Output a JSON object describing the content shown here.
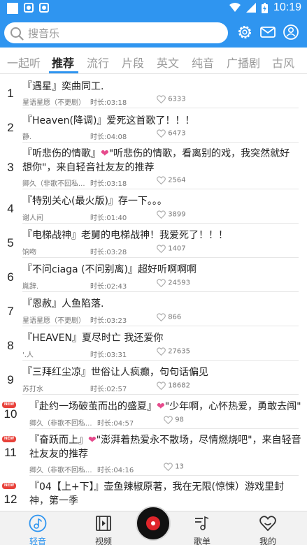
{
  "status": {
    "time": "10:19"
  },
  "search": {
    "placeholder": "搜音乐"
  },
  "tabs": [
    {
      "label": "一起听",
      "active": false
    },
    {
      "label": "推荐",
      "active": true
    },
    {
      "label": "流行",
      "active": false
    },
    {
      "label": "片段",
      "active": false
    },
    {
      "label": "英文",
      "active": false
    },
    {
      "label": "纯音",
      "active": false
    },
    {
      "label": "广播剧",
      "active": false
    },
    {
      "label": "古风",
      "active": false
    }
  ],
  "songs": [
    {
      "rank": "1",
      "title": "『遇星』奕曲同工.",
      "author": "星语星愿（不更剧）",
      "duration": "时长:03:18",
      "likes": "6333",
      "new": false
    },
    {
      "rank": "2",
      "title": "『Heaven(降调)』爱死这首歌了！！！",
      "author": "静.",
      "duration": "时长:04:08",
      "likes": "6473",
      "new": false
    },
    {
      "rank": "3",
      "title_pre": "『听悲伤的情歌』",
      "title_post": "\"听悲伤的情歌，看离别的戏，我突然就好想你\"，来自轻音社友友的推荐",
      "author": "卿久（非歌不回私...",
      "duration": "时长:03:18",
      "likes": "2564",
      "new": false
    },
    {
      "rank": "4",
      "title": "『特别关心(最火版)』存一下。。。",
      "author": "谢人间",
      "duration": "时长:01:40",
      "likes": "3899",
      "new": false
    },
    {
      "rank": "5",
      "title": "『电梯战神』老舅的电梯战神！我爱死了！！！",
      "author": "饷吻",
      "duration": "时长:03:28",
      "likes": "1407",
      "new": false
    },
    {
      "rank": "6",
      "title": "『不问ciaga (不问别离)』超好听啊啊啊",
      "author": "胤辞.",
      "duration": "时长:02:43",
      "likes": "24593",
      "new": false
    },
    {
      "rank": "7",
      "title": "『恩赦』人鱼陷落.",
      "author": "星语星愿（不更剧）",
      "duration": "时长:03:23",
      "likes": "866",
      "new": false
    },
    {
      "rank": "8",
      "title": "『HEAVEN』夏尽时亡 我还爱你",
      "author": "'.人",
      "duration": "时长:03:31",
      "likes": "27635",
      "new": false
    },
    {
      "rank": "9",
      "title": "『三拜红尘凉』世俗让人疯癫，句句话偏见",
      "author": "苏打水",
      "duration": "时长:02:57",
      "likes": "18682",
      "new": false
    },
    {
      "rank": "10",
      "title_pre": "『赴约一场破茧而出的盛夏』",
      "title_post": "\"少年啊，心怀热爱，勇敢去闯\"",
      "author": "卿久（非歌不回私...",
      "duration": "时长:04:57",
      "likes": "98",
      "new": true
    },
    {
      "rank": "11",
      "title_pre": "『奋跃而上』",
      "title_post": "\"澎湃着热爱永不散场，尽情燃烧吧\"，来自轻音社友友的推荐",
      "author": "卿久（非歌不回私...",
      "duration": "时长:04:16",
      "likes": "13",
      "new": true
    },
    {
      "rank": "12",
      "title": "『04【上+下】』壶鱼辣椒原著，我在无限(惊悚）游戏里封神，第一季",
      "author": "",
      "duration": "",
      "likes": "",
      "new": true
    }
  ],
  "new_badge": "NEW",
  "nav": [
    {
      "label": "轻音",
      "icon": "music-note-icon",
      "active": true
    },
    {
      "label": "视频",
      "icon": "video-icon",
      "active": false
    },
    {
      "label": "歌单",
      "icon": "playlist-icon",
      "active": false
    },
    {
      "label": "我的",
      "icon": "heart-profile-icon",
      "active": false
    }
  ],
  "colors": {
    "accent": "#2f95f0",
    "heart": "#e64a8c",
    "new_badge": "#e8413a"
  }
}
